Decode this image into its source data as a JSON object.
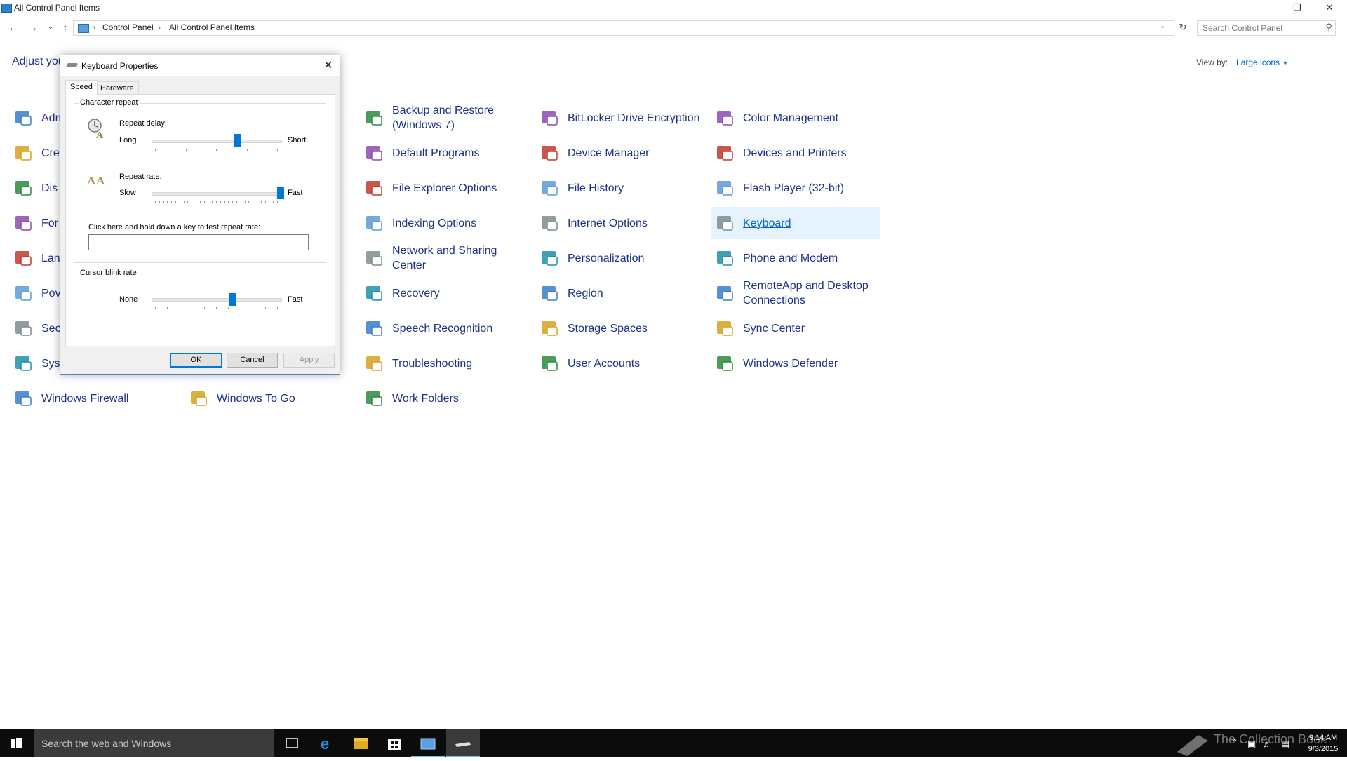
{
  "window": {
    "title": "All Control Panel Items",
    "minimize_icon": "minimize-icon",
    "restore_icon": "restore-icon",
    "close_icon": "close-icon"
  },
  "address_bar": {
    "breadcrumb": [
      "Control Panel",
      "All Control Panel Items"
    ],
    "search_placeholder": "Search Control Panel"
  },
  "header": {
    "title_visible": "Adjust you",
    "view_by_label": "View by:",
    "view_by_value": "Large icons"
  },
  "items": [
    {
      "label": "Adm",
      "icon": "admin-tools-icon"
    },
    {
      "label": "Cre",
      "icon": "credential-manager-icon"
    },
    {
      "label": "Dis",
      "icon": "display-icon"
    },
    {
      "label": "For",
      "icon": "fonts-icon"
    },
    {
      "label": "Lan",
      "icon": "language-icon"
    },
    {
      "label": "Pov",
      "icon": "power-options-icon"
    },
    {
      "label": "Sec",
      "icon": "security-maintenance-icon"
    },
    {
      "label": "Sys",
      "icon": "system-icon"
    },
    {
      "label": "Windows Firewall",
      "icon": "firewall-icon"
    },
    {
      "label": "Windows To Go",
      "icon": "windows-to-go-icon"
    },
    {
      "label": "Backup and Restore (Windows 7)",
      "icon": "backup-restore-icon"
    },
    {
      "label": "Default Programs",
      "icon": "default-programs-icon"
    },
    {
      "label": "File Explorer Options",
      "icon": "file-explorer-options-icon"
    },
    {
      "label": "Indexing Options",
      "icon": "indexing-options-icon"
    },
    {
      "label": "Network and Sharing Center",
      "icon": "network-sharing-icon"
    },
    {
      "label": "Recovery",
      "icon": "recovery-icon"
    },
    {
      "label": "Speech Recognition",
      "icon": "microphone-icon"
    },
    {
      "label": "Troubleshooting",
      "icon": "troubleshooting-icon"
    },
    {
      "label": "Work Folders",
      "icon": "work-folders-icon"
    },
    {
      "label": "BitLocker Drive Encryption",
      "icon": "bitlocker-icon"
    },
    {
      "label": "Device Manager",
      "icon": "device-manager-icon"
    },
    {
      "label": "File History",
      "icon": "file-history-icon"
    },
    {
      "label": "Internet Options",
      "icon": "internet-options-icon"
    },
    {
      "label": "Personalization",
      "icon": "personalization-icon"
    },
    {
      "label": "Region",
      "icon": "region-icon"
    },
    {
      "label": "Storage Spaces",
      "icon": "storage-spaces-icon"
    },
    {
      "label": "User Accounts",
      "icon": "user-accounts-icon"
    },
    {
      "label": "Color Management",
      "icon": "color-management-icon"
    },
    {
      "label": "Devices and Printers",
      "icon": "devices-printers-icon"
    },
    {
      "label": "Flash Player (32-bit)",
      "icon": "flash-player-icon"
    },
    {
      "label": "Keyboard",
      "icon": "keyboard-icon",
      "selected": true
    },
    {
      "label": "Phone and Modem",
      "icon": "phone-modem-icon"
    },
    {
      "label": "RemoteApp and Desktop Connections",
      "icon": "remoteapp-icon"
    },
    {
      "label": "Sync Center",
      "icon": "sync-center-icon"
    },
    {
      "label": "Windows Defender",
      "icon": "windows-defender-icon"
    }
  ],
  "dialog": {
    "title": "Keyboard Properties",
    "tabs": [
      "Speed",
      "Hardware"
    ],
    "active_tab": "Speed",
    "character_repeat": {
      "group_label": "Character repeat",
      "repeat_delay_label": "Repeat delay:",
      "repeat_delay_min": "Long",
      "repeat_delay_max": "Short",
      "repeat_delay_value": 0.667,
      "repeat_rate_label": "Repeat rate:",
      "repeat_rate_min": "Slow",
      "repeat_rate_max": "Fast",
      "repeat_rate_value": 1.0,
      "test_label": "Click here and hold down a key to test repeat rate:",
      "test_value": ""
    },
    "cursor_blink": {
      "group_label": "Cursor blink rate",
      "min": "None",
      "max": "Fast",
      "value": 0.63
    },
    "buttons": {
      "ok": "OK",
      "cancel": "Cancel",
      "apply": "Apply"
    }
  },
  "taskbar": {
    "search_placeholder": "Search the web and Windows",
    "apps": [
      "task-view-icon",
      "edge-icon",
      "file-explorer-icon",
      "store-icon",
      "control-panel-icon",
      "keyboard-icon"
    ],
    "watermark": "The Collection Book",
    "time": "9:14 AM",
    "date": "9/3/2015"
  },
  "colors": {
    "link": "#1e3287",
    "selected_bg": "#e5f3ff",
    "accent": "#0078d7"
  }
}
